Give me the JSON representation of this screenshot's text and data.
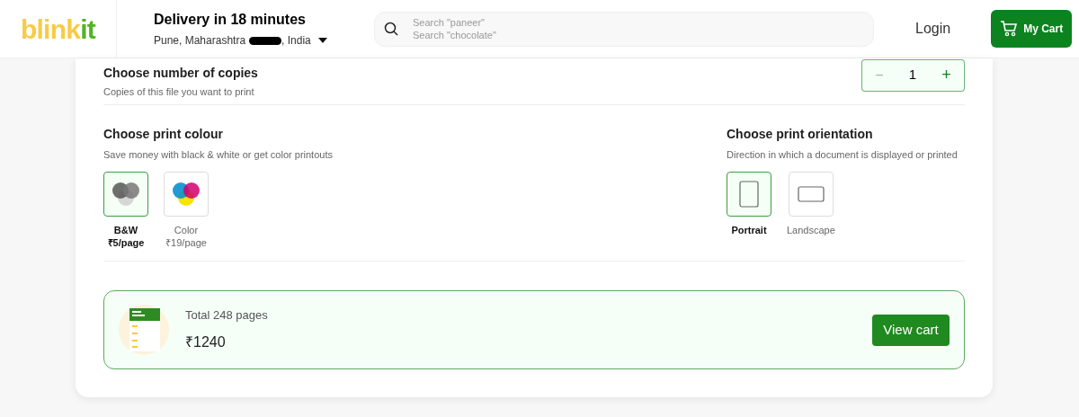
{
  "header": {
    "logo": {
      "part_1": "blink",
      "part_2": "it"
    },
    "delivery_title": "Delivery in 18 minutes",
    "address_start": "Pune, Maharashtra",
    "address_end": ", India",
    "search_placeholders": [
      "Search \"paneer\"",
      "Search \"chocolate\""
    ],
    "login": "Login",
    "cart_button": "My Cart"
  },
  "copies": {
    "title": "Choose number of copies",
    "subtitle": "Copies of this file you want to print",
    "minus": "−",
    "value": "1",
    "plus": "+"
  },
  "colour": {
    "title": "Choose print colour",
    "subtitle": "Save money with black & white or get color printouts",
    "options": [
      {
        "kind": "bw",
        "label": "B&W",
        "price": "₹5/page",
        "selected": true
      },
      {
        "kind": "color",
        "label": "Color",
        "price": "₹19/page",
        "selected": false
      }
    ]
  },
  "orientation": {
    "title": "Choose print orientation",
    "subtitle": "Direction in which a document is displayed or printed",
    "options": [
      {
        "kind": "portrait",
        "label": "Portrait",
        "selected": true
      },
      {
        "kind": "landscape",
        "label": "Landscape",
        "selected": false
      }
    ]
  },
  "summary": {
    "pages": "Total 248 pages",
    "price": "₹1240",
    "button": "View cart"
  }
}
